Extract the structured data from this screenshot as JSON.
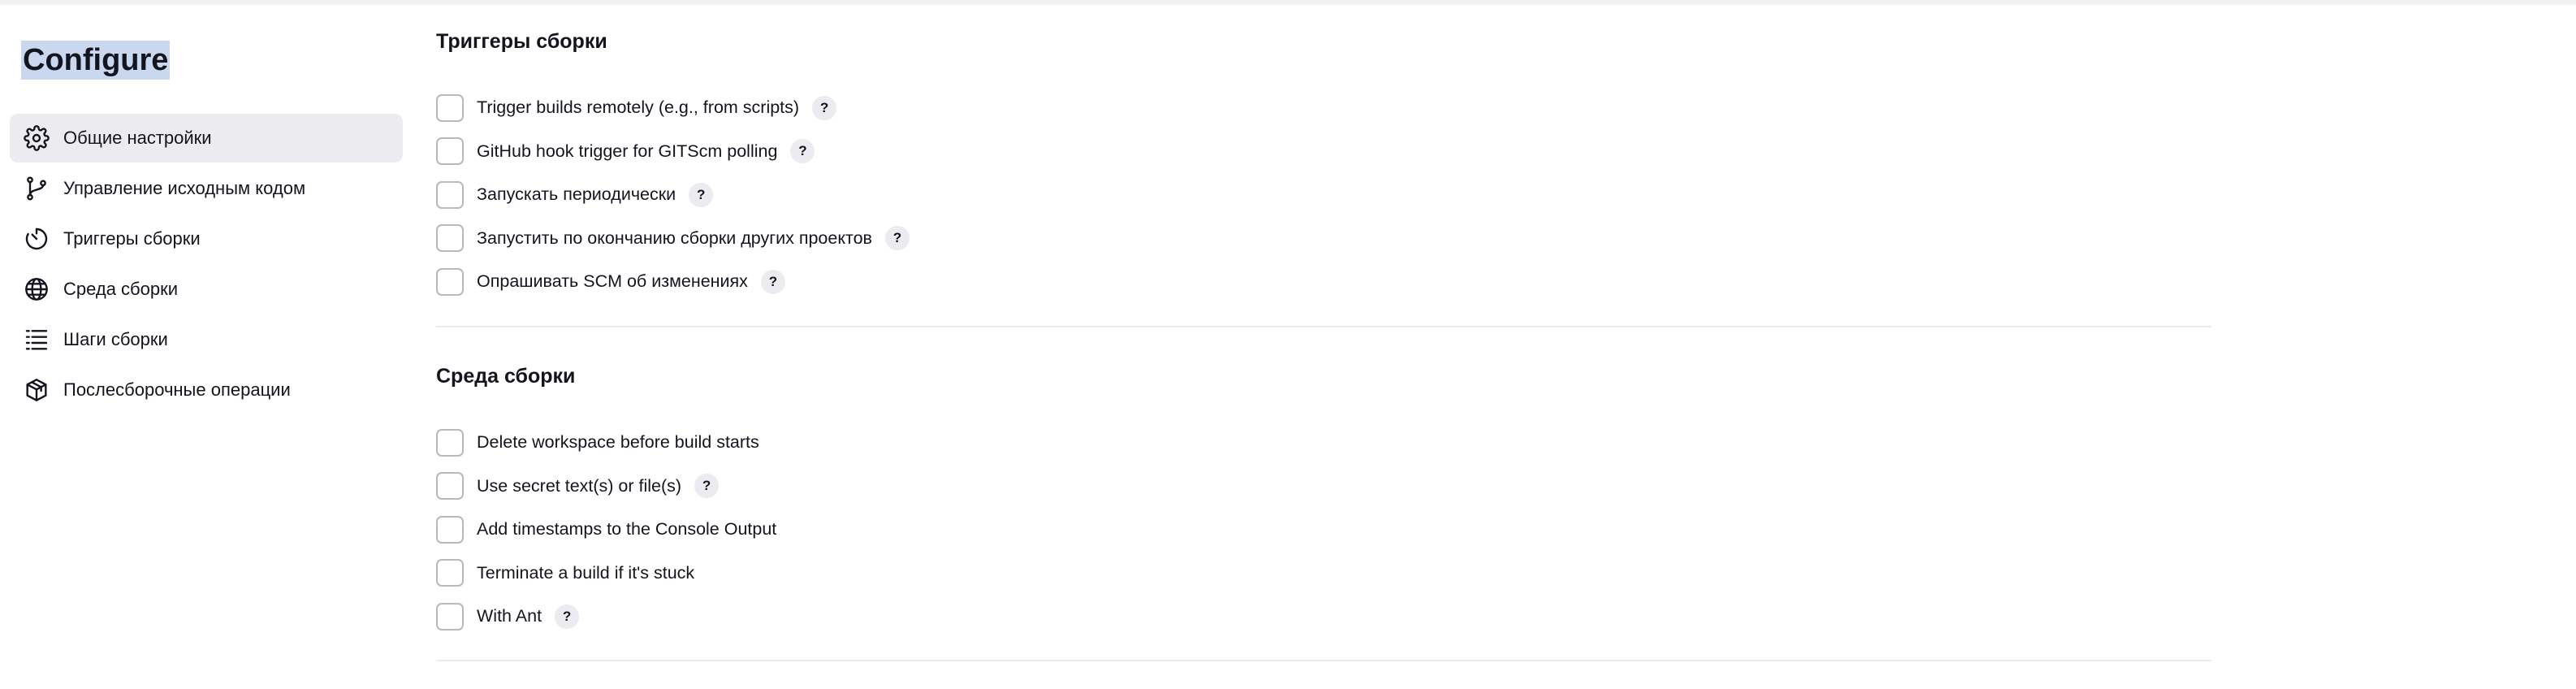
{
  "page": {
    "title": "Configure"
  },
  "sidebar": {
    "items": [
      {
        "label": "Общие настройки",
        "icon": "gear-icon",
        "active": true
      },
      {
        "label": "Управление исходным кодом",
        "icon": "branch-icon",
        "active": false
      },
      {
        "label": "Триггеры сборки",
        "icon": "timer-icon",
        "active": false
      },
      {
        "label": "Среда сборки",
        "icon": "globe-icon",
        "active": false
      },
      {
        "label": "Шаги сборки",
        "icon": "list-icon",
        "active": false
      },
      {
        "label": "Послесборочные операции",
        "icon": "package-icon",
        "active": false
      }
    ]
  },
  "sections": {
    "triggers": {
      "title": "Триггеры сборки",
      "options": [
        {
          "label": "Trigger builds remotely (e.g., from scripts)",
          "checked": false,
          "help": "?"
        },
        {
          "label": "GitHub hook trigger for GITScm polling",
          "checked": false,
          "help": "?"
        },
        {
          "label": "Запускать периодически",
          "checked": false,
          "help": "?"
        },
        {
          "label": "Запустить по окончанию сборки других проектов",
          "checked": false,
          "help": "?"
        },
        {
          "label": "Опрашивать SCM об изменениях",
          "checked": false,
          "help": "?"
        }
      ]
    },
    "environment": {
      "title": "Среда сборки",
      "options": [
        {
          "label": "Delete workspace before build starts",
          "checked": false
        },
        {
          "label": "Use secret text(s) or file(s)",
          "checked": false,
          "help": "?"
        },
        {
          "label": "Add timestamps to the Console Output",
          "checked": false
        },
        {
          "label": "Terminate a build if it's stuck",
          "checked": false
        },
        {
          "label": "With Ant",
          "checked": false,
          "help": "?"
        }
      ]
    }
  },
  "colors": {
    "active_nav_bg": "#ececf0",
    "title_highlight": "#c9d8ef",
    "help_bg": "#ececf0",
    "checkbox_border": "#b8b8c0"
  }
}
